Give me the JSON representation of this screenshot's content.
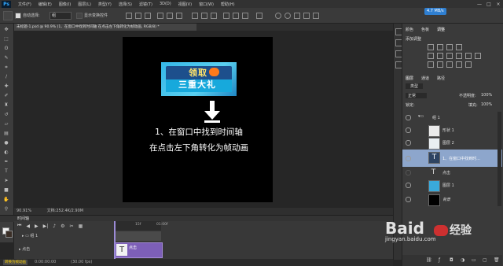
{
  "menubar": {
    "app_logo": "Ps",
    "items": [
      "文件(F)",
      "编辑(E)",
      "图像(I)",
      "图层(L)",
      "类型(Y)",
      "选择(S)",
      "滤镜(T)",
      "3D(D)",
      "视图(V)",
      "窗口(W)",
      "帮助(H)"
    ],
    "window_controls": [
      "—",
      "□",
      "×"
    ],
    "net_badge": "4.7 MB/s"
  },
  "options": {
    "auto_select": "自动选择:",
    "group_value": "组",
    "show_transform": "显示变换控件"
  },
  "document": {
    "tab_title": "未标题-1.psd @ 90.9% (1、在窗口中找到时间轴 在点击左下角转化为帧动画, RGB/8) *",
    "banner_line1": "领取",
    "banner_line2": "三重大礼",
    "step1": "1、在窗口中找到时间轴",
    "step2": "在点击左下角转化为帧动画",
    "zoom": "90.91%",
    "doc_size": "文档:252.4K/2.90M"
  },
  "timeline": {
    "ruler_marks": [
      "15f",
      "01:00f"
    ],
    "group_label": "组 1",
    "point_label": "点击",
    "clip_label": "点击",
    "convert_label": "转换为帧动画",
    "timecode": "0:00:00:00",
    "fps": "(30.00 fps)"
  },
  "panels": {
    "tabs_top": [
      "颜色",
      "色板",
      "调整"
    ],
    "adjust_heading": "添加调整",
    "tabs_layers": [
      "图层",
      "通道",
      "路径"
    ],
    "filter_kind": "类型",
    "blend_mode": "正常",
    "opacity_label": "不透明度:",
    "opacity_value": "100%",
    "lock_label": "锁定:",
    "fill_label": "填充:",
    "fill_value": "100%",
    "layers": [
      {
        "name": "组 1",
        "kind": "group"
      },
      {
        "name": "形状 1",
        "kind": "shape"
      },
      {
        "name": "图层 2",
        "kind": "pixel"
      },
      {
        "name": "1、在窗口中找到时...",
        "kind": "text",
        "selected": true
      },
      {
        "name": "点击",
        "kind": "text"
      },
      {
        "name": "图层 1",
        "kind": "pixel"
      },
      {
        "name": "背景",
        "kind": "background"
      }
    ]
  },
  "watermark": {
    "brand": "Baid",
    "brand_tail": "经验",
    "url": "jingyan.baidu.com"
  },
  "tools": [
    "move-icon",
    "marquee-icon",
    "lasso-icon",
    "quick-select-icon",
    "crop-icon",
    "eyedropper-icon",
    "healing-icon",
    "brush-icon",
    "stamp-icon",
    "history-brush-icon",
    "eraser-icon",
    "gradient-icon",
    "blur-icon",
    "dodge-icon",
    "pen-icon",
    "type-icon",
    "path-select-icon",
    "shape-icon",
    "hand-icon",
    "zoom-icon"
  ]
}
